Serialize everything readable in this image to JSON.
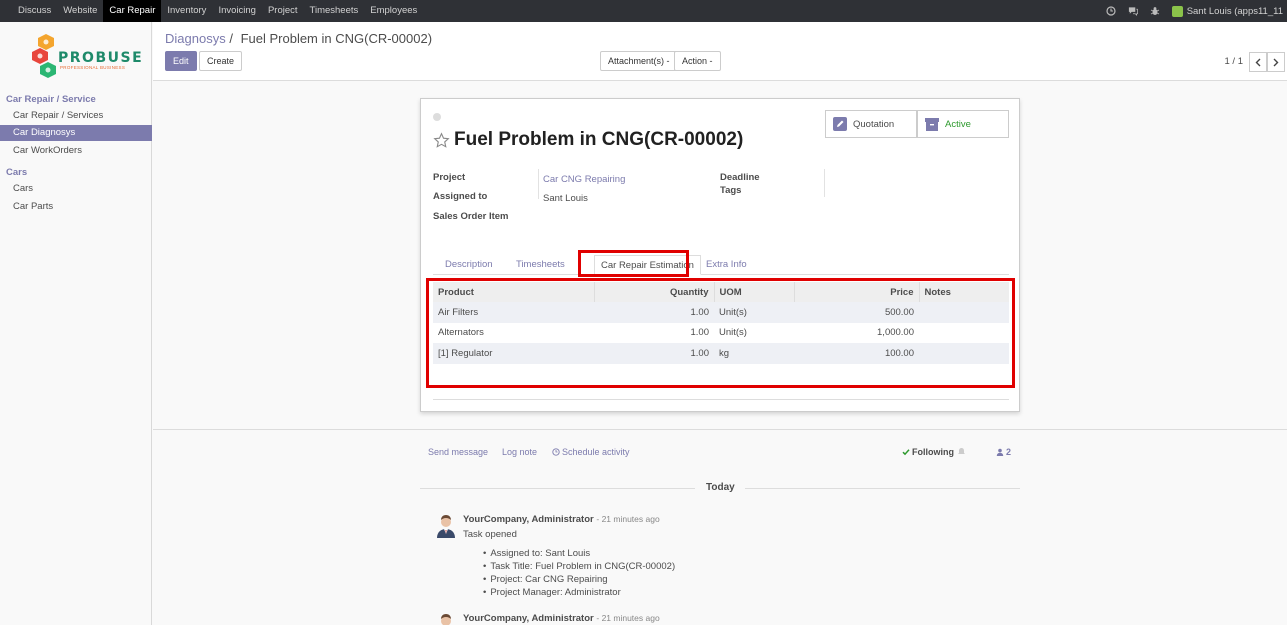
{
  "topbar": {
    "menu": [
      "Discuss",
      "Website",
      "Car Repair",
      "Inventory",
      "Invoicing",
      "Project",
      "Timesheets",
      "Employees"
    ],
    "active_index": 2,
    "user": "Sant Louis (apps11_11"
  },
  "sidebar": {
    "logo_text": "PROBUSE",
    "logo_sub": "PROFESSIONAL BUSINESS",
    "sections": [
      {
        "title": "Car Repair / Service",
        "items": [
          "Car Repair / Services",
          "Car Diagnosys",
          "Car WorkOrders"
        ]
      },
      {
        "title": "Cars",
        "items": [
          "Cars",
          "Car Parts"
        ]
      }
    ],
    "active_item": "Car Diagnosys"
  },
  "control_panel": {
    "breadcrumb_parent": "Diagnosys",
    "breadcrumb_sep": "/",
    "breadcrumb_current": "Fuel Problem in CNG(CR-00002)",
    "edit_label": "Edit",
    "create_label": "Create",
    "attachments_label": "Attachment(s) -",
    "action_label": "Action -",
    "pager": "1 / 1"
  },
  "form": {
    "title": "Fuel Problem in CNG(CR-00002)",
    "smart_buttons": {
      "quotation": "Quotation",
      "active": "Active"
    },
    "fields": {
      "project_label": "Project",
      "project_value": "Car CNG Repairing",
      "assigned_label": "Assigned to",
      "assigned_value": "Sant Louis",
      "sales_order_label": "Sales Order Item",
      "deadline_label": "Deadline",
      "tags_label": "Tags"
    },
    "tabs": [
      "Description",
      "Timesheets",
      "Car Repair Estimation",
      "Extra Info"
    ],
    "active_tab": "Car Repair Estimation",
    "table": {
      "headers": [
        "Product",
        "Quantity",
        "UOM",
        "Price",
        "Notes"
      ],
      "rows": [
        [
          "Air Filters",
          "1.00",
          "Unit(s)",
          "500.00",
          ""
        ],
        [
          "Alternators",
          "1.00",
          "Unit(s)",
          "1,000.00",
          ""
        ],
        [
          "[1] Regulator",
          "1.00",
          "kg",
          "100.00",
          ""
        ]
      ]
    }
  },
  "chatter": {
    "send_message": "Send message",
    "log_note": "Log note",
    "schedule_activity": "Schedule activity",
    "following": "Following",
    "followers_count": "2",
    "today_label": "Today",
    "messages": [
      {
        "author": "YourCompany, Administrator",
        "ago": "- 21 minutes ago",
        "body": "Task opened",
        "tracking": [
          "Assigned to: Sant Louis",
          "Task Title: Fuel Problem in CNG(CR-00002)",
          "Project: Car CNG Repairing",
          "Project Manager: Administrator"
        ]
      },
      {
        "author": "YourCompany, Administrator",
        "ago": "- 21 minutes ago"
      }
    ]
  },
  "colors": {
    "primary": "#7c7bad",
    "topbar": "#2f3136",
    "highlight": "#e00000",
    "active_state": "#2e9a2e"
  }
}
